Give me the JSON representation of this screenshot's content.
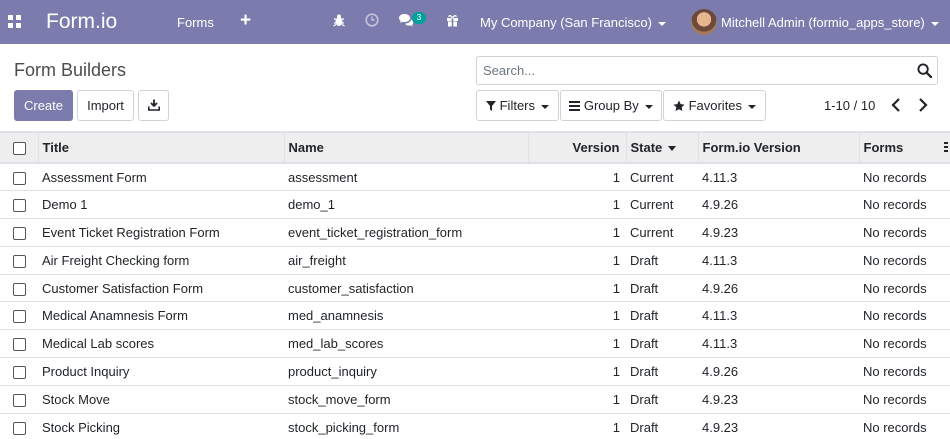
{
  "navbar": {
    "brand": "Form.io",
    "menu_forms": "Forms",
    "plus_label": "+",
    "chat_badge": "3",
    "company": "My Company (San Francisco)",
    "user": "Mitchell Admin (formio_apps_store)",
    "color": "#7c7bad"
  },
  "page": {
    "title": "Form Builders",
    "search_placeholder": "Search...",
    "create_label": "Create",
    "import_label": "Import",
    "filters_label": "Filters",
    "groupby_label": "Group By",
    "favorites_label": "Favorites",
    "pager": "1-10 / 10"
  },
  "table": {
    "headers": {
      "title": "Title",
      "name": "Name",
      "version": "Version",
      "state": "State",
      "formio_version": "Form.io Version",
      "forms": "Forms"
    },
    "rows": [
      {
        "title": "Assessment Form",
        "name": "assessment",
        "version": "1",
        "state": "Current",
        "formio_version": "4.11.3",
        "forms": "No records"
      },
      {
        "title": "Demo 1",
        "name": "demo_1",
        "version": "1",
        "state": "Current",
        "formio_version": "4.9.26",
        "forms": "No records"
      },
      {
        "title": "Event Ticket Registration Form",
        "name": "event_ticket_registration_form",
        "version": "1",
        "state": "Current",
        "formio_version": "4.9.23",
        "forms": "No records"
      },
      {
        "title": "Air Freight Checking form",
        "name": "air_freight",
        "version": "1",
        "state": "Draft",
        "formio_version": "4.11.3",
        "forms": "No records"
      },
      {
        "title": "Customer Satisfaction Form",
        "name": "customer_satisfaction",
        "version": "1",
        "state": "Draft",
        "formio_version": "4.9.26",
        "forms": "No records"
      },
      {
        "title": "Medical Anamnesis Form",
        "name": "med_anamnesis",
        "version": "1",
        "state": "Draft",
        "formio_version": "4.11.3",
        "forms": "No records"
      },
      {
        "title": "Medical Lab scores",
        "name": "med_lab_scores",
        "version": "1",
        "state": "Draft",
        "formio_version": "4.11.3",
        "forms": "No records"
      },
      {
        "title": "Product Inquiry",
        "name": "product_inquiry",
        "version": "1",
        "state": "Draft",
        "formio_version": "4.9.26",
        "forms": "No records"
      },
      {
        "title": "Stock Move",
        "name": "stock_move_form",
        "version": "1",
        "state": "Draft",
        "formio_version": "4.9.23",
        "forms": "No records"
      },
      {
        "title": "Stock Picking",
        "name": "stock_picking_form",
        "version": "1",
        "state": "Draft",
        "formio_version": "4.9.23",
        "forms": "No records"
      }
    ]
  }
}
